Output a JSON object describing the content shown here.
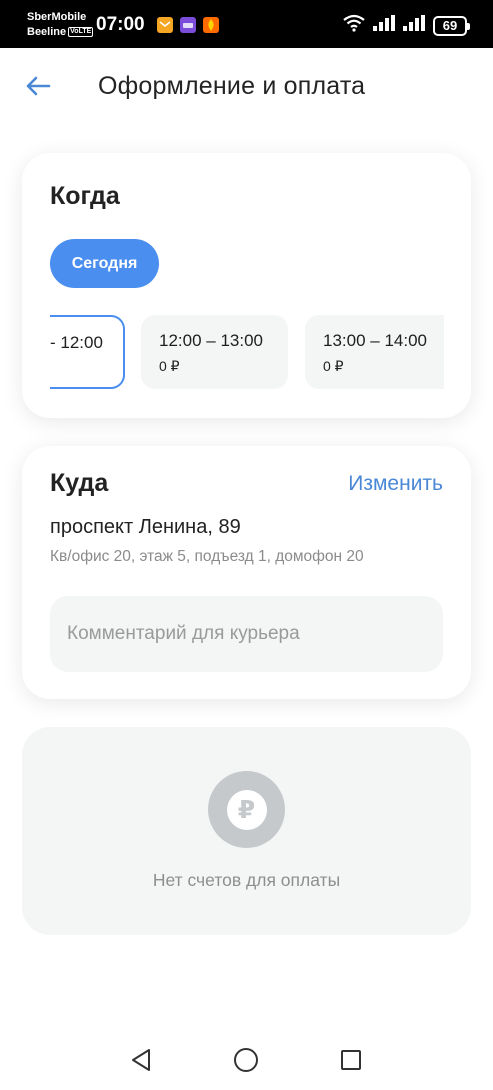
{
  "status_bar": {
    "carrier1": "SberMobile",
    "carrier2": "Beeline",
    "volte": "VoLTE",
    "time": "07:00",
    "battery": "69"
  },
  "header": {
    "title": "Оформление и оплата"
  },
  "when_card": {
    "title": "Когда",
    "day_chip": "Сегодня",
    "slots": [
      {
        "time": "- 12:00",
        "price": "",
        "selected": true
      },
      {
        "time": "12:00 – 13:00",
        "price": "0 ₽",
        "selected": false
      },
      {
        "time": "13:00 – 14:00",
        "price": "0 ₽",
        "selected": false
      }
    ]
  },
  "where_card": {
    "title": "Куда",
    "change_label": "Изменить",
    "address": "проспект Ленина, 89",
    "details": "Кв/офис 20, этаж 5, подъезд 1, домофон 20",
    "comment_placeholder": "Комментарий для курьера",
    "comment_value": ""
  },
  "payment_card": {
    "empty_text": "Нет счетов для оплаты",
    "currency_symbol": "₽"
  },
  "colors": {
    "accent": "#4a8ef0",
    "link": "#4a88d6",
    "muted_bg": "#f4f5f5"
  }
}
